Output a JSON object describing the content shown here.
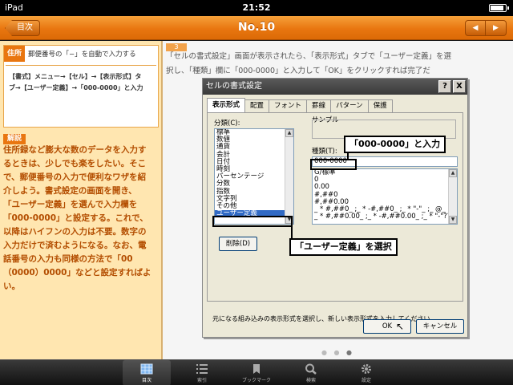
{
  "status_bar": {
    "device": "iPad",
    "time": "21:52"
  },
  "nav": {
    "back_label": "目次",
    "title": "No.10",
    "prev_icon": "triangle-left-icon",
    "next_icon": "triangle-right-icon"
  },
  "tip": {
    "tag": "住所",
    "title": "郵便番号の「−」を自動で入力する",
    "steps_line1": "【書式】メニュー→【セル】→【表示形式】タ",
    "steps_line2": "ブ→【ユーザー定義】→「000-0000」と入力"
  },
  "kaisetsu": {
    "tag": "解説",
    "lines": [
      "住所録など膨大な数のデータを入力す",
      "るときは、少しでも楽をしたい。そこ",
      "で、郵便番号の入力で便利なワザを紹",
      "介しよう。書式設定の画面を開き、",
      "「ユーザー定義」を選んで入力欄を",
      "「000-0000」と設定する。これで、",
      "以降はハイフンの入力は不要。数字の",
      "入力だけで済むようになる。なお、電",
      "話番号の入力も同様の方法で「00",
      "（0000）0000」などと設定すればよ",
      "い。"
    ]
  },
  "step": {
    "number": "3",
    "line1": "「セルの書式設定」画面が表示されたら、「表示形式」タブで「ユーザー定義」を選",
    "line2": "択し、「種類」欄に「000-0000」と入力して「OK」をクリックすれば完了だ"
  },
  "dialog": {
    "title": "セルの書式設定",
    "help_btn": "?",
    "close_btn": "X",
    "tabs": [
      "表示形式",
      "配置",
      "フォント",
      "罫線",
      "パターン",
      "保護"
    ],
    "category_label": "分類(C):",
    "categories": [
      "標準",
      "数値",
      "通貨",
      "会計",
      "日付",
      "時刻",
      "パーセンテージ",
      "分数",
      "指数",
      "文字列",
      "その他",
      "ユーザー定義"
    ],
    "sample_label": "サンプル",
    "type_label": "種類(T):",
    "type_value": "000-0000",
    "formats": [
      "G/標準",
      "0",
      "0.00",
      "#,##0",
      "#,##0.00",
      "_ * #,##0_ ;_ * -#,##0_ ;_ * \"-\"_ ;_ @_",
      "_ * #,##0.00_ ;_ * -#,##0.00_ ;_ * \"-\"??_"
    ],
    "delete_btn": "削除(D)",
    "description": "元になる組み込みの表示形式を選択し、新しい表示形式を入力してください。",
    "ok_btn": "OK",
    "cancel_btn": "キャンセル"
  },
  "callouts": {
    "input": "「000-0000」と入力",
    "select": "「ユーザー定義」を選択"
  },
  "tab_bar": [
    {
      "label": "目次",
      "icon": "grid-icon",
      "active": true
    },
    {
      "label": "索引",
      "icon": "list-icon",
      "active": false
    },
    {
      "label": "ブックマーク",
      "icon": "bookmark-icon",
      "active": false
    },
    {
      "label": "検索",
      "icon": "search-icon",
      "active": false
    },
    {
      "label": "設定",
      "icon": "gear-icon",
      "active": false
    }
  ]
}
